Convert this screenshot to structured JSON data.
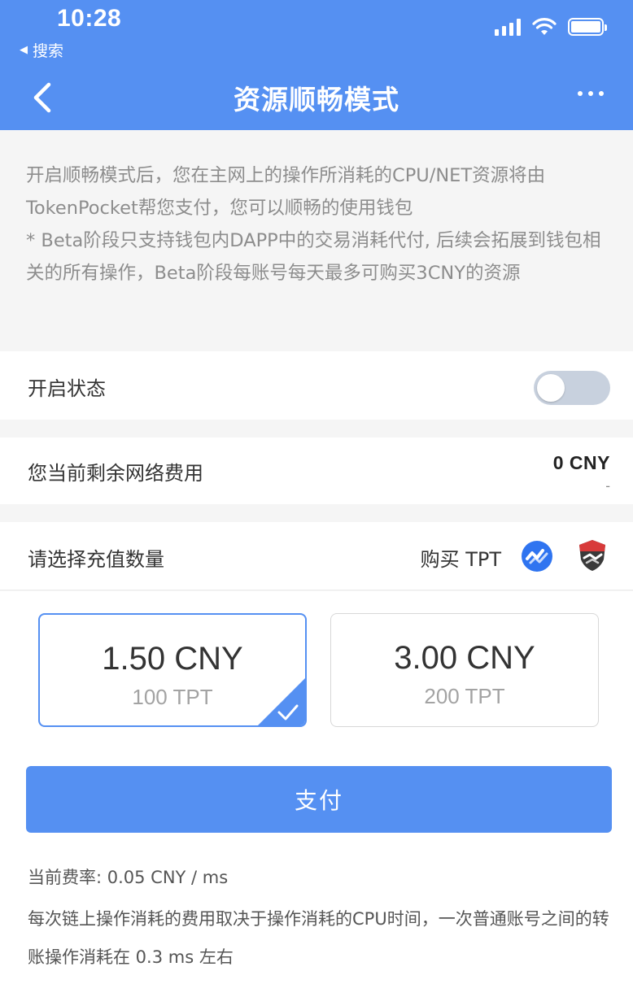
{
  "status_bar": {
    "time": "10:28",
    "back_app": "搜索"
  },
  "nav": {
    "title": "资源顺畅模式"
  },
  "intro": {
    "line1": "开启顺畅模式后，您在主网上的操作所消耗的CPU/NET资源将由TokenPocket帮您支付，您可以顺畅的使用钱包",
    "line2": "* Beta阶段只支持钱包内DAPP中的交易消耗代付, 后续会拓展到钱包相关的所有操作，Beta阶段每账号每天最多可购买3CNY的资源"
  },
  "status_row": {
    "label": "开启状态",
    "enabled": false
  },
  "fee_row": {
    "label": "您当前剩余网络费用",
    "value": "0 CNY",
    "sub": "-"
  },
  "select_row": {
    "label": "请选择充值数量",
    "buy_label": "购买 TPT",
    "icons": [
      "blue-check-wave-icon",
      "red-shield-handshake-icon"
    ]
  },
  "options": [
    {
      "price": "1.50 CNY",
      "tpt": "100 TPT",
      "selected": true
    },
    {
      "price": "3.00 CNY",
      "tpt": "200 TPT",
      "selected": false
    }
  ],
  "pay_button": "支付",
  "rate_text": "当前费率: 0.05 CNY / ms",
  "note_text": "每次链上操作消耗的费用取决于操作消耗的CPU时间，一次普通账号之间的转账操作消耗在 0.3 ms 左右",
  "colors": {
    "primary": "#5590f2",
    "toggle_off": "#c8d1de",
    "muted_text": "#8d8d8d"
  }
}
